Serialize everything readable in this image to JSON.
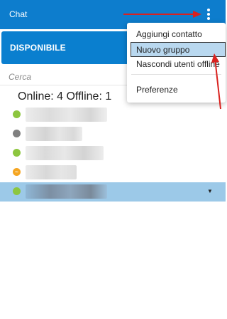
{
  "header": {
    "title": "Chat",
    "menu_icon": "vertical-ellipsis-icon"
  },
  "status": {
    "label": "DISPONIBILE"
  },
  "search": {
    "placeholder": "Cerca"
  },
  "counts": {
    "text": "Online: 4 Offline: 1"
  },
  "contacts": [
    {
      "status": "online",
      "dot_color": "#8dc63f",
      "name_redacted": true
    },
    {
      "status": "offline",
      "dot_color": "#808080",
      "name_redacted": true
    },
    {
      "status": "online",
      "dot_color": "#8dc63f",
      "name_redacted": true
    },
    {
      "status": "away",
      "dot_color": "#f5a623",
      "away_glyph": "~",
      "name_redacted": true
    },
    {
      "status": "online",
      "dot_color": "#8dc63f",
      "name_redacted": true,
      "selected": true,
      "expand_icon": "caret-down-icon"
    }
  ],
  "menu": {
    "items": [
      {
        "label": "Aggiungi contatto"
      },
      {
        "label": "Nuovo gruppo",
        "highlighted": true
      },
      {
        "label": "Nascondi utenti offline"
      },
      {
        "label": "Preferenze"
      }
    ]
  },
  "colors": {
    "header_bg": "#0d7dcd",
    "status_bg": "#0a7fcf",
    "selected_row": "#9cc9e8",
    "annotation_arrow": "#d9221f"
  }
}
